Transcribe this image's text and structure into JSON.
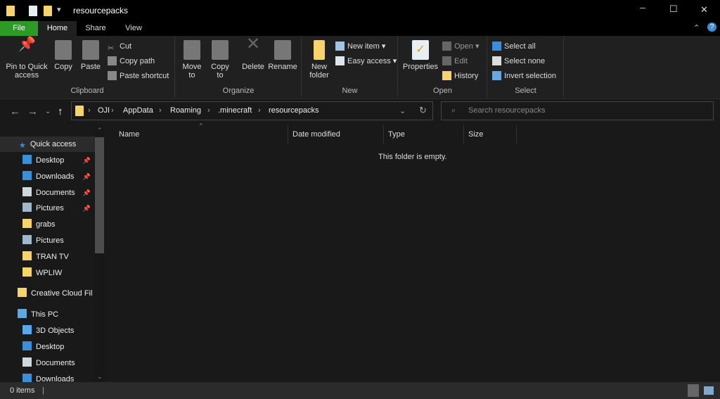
{
  "window": {
    "title": "resourcepacks",
    "minimize": "─",
    "maximize": "☐",
    "close": "✕"
  },
  "tabs": [
    {
      "label": "File"
    },
    {
      "label": "Home"
    },
    {
      "label": "Share"
    },
    {
      "label": "View"
    }
  ],
  "ribbon": {
    "clipboard": {
      "label": "Clipboard",
      "pin": "Pin to Quick access",
      "copy": "Copy",
      "paste": "Paste",
      "cut": "Cut",
      "copy_path": "Copy path",
      "paste_shortcut": "Paste shortcut"
    },
    "organize": {
      "label": "Organize",
      "move_to": "Move to",
      "copy_to": "Copy to",
      "delete": "Delete",
      "rename": "Rename"
    },
    "new": {
      "label": "New",
      "new_folder": "New folder",
      "new_item": "New item ▾",
      "easy_access": "Easy access ▾"
    },
    "open": {
      "label": "Open",
      "properties": "Properties",
      "open": "Open ▾",
      "edit": "Edit",
      "history": "History"
    },
    "select": {
      "label": "Select",
      "select_all": "Select all",
      "select_none": "Select none",
      "invert": "Invert selection"
    }
  },
  "address": {
    "crumbs": [
      "OJI",
      "AppData",
      "Roaming",
      ".minecraft",
      "resourcepacks"
    ],
    "search_placeholder": "Search resourcepacks"
  },
  "nav": {
    "quick_access": "Quick access",
    "items": [
      {
        "label": "Desktop",
        "pinned": true,
        "icon": "desktop-icon",
        "color": "#3b8fd9"
      },
      {
        "label": "Downloads",
        "pinned": true,
        "icon": "download-icon",
        "color": "#3b8fd9"
      },
      {
        "label": "Documents",
        "pinned": true,
        "icon": "document-icon",
        "color": "#cfd8dc"
      },
      {
        "label": "Pictures",
        "pinned": true,
        "icon": "pictures-icon",
        "color": "#9fb8cc"
      },
      {
        "label": "grabs",
        "pinned": false,
        "icon": "folder-icon",
        "color": "#f7d46b"
      },
      {
        "label": "Pictures",
        "pinned": false,
        "icon": "pictures-icon",
        "color": "#9fb8cc"
      },
      {
        "label": "TRAN TV",
        "pinned": false,
        "icon": "folder-icon",
        "color": "#f7d46b"
      },
      {
        "label": "WPLIW",
        "pinned": false,
        "icon": "folder-icon",
        "color": "#f7d46b"
      }
    ],
    "creative_cloud": "Creative Cloud Fil",
    "this_pc": "This PC",
    "pc_items": [
      {
        "label": "3D Objects",
        "color": "#5aa9e6"
      },
      {
        "label": "Desktop",
        "color": "#3b8fd9"
      },
      {
        "label": "Documents",
        "color": "#cfd8dc"
      },
      {
        "label": "Downloads",
        "color": "#3b8fd9"
      }
    ]
  },
  "columns": [
    "Name",
    "Date modified",
    "Type",
    "Size"
  ],
  "empty_message": "This folder is empty.",
  "status": {
    "items": "0 items"
  },
  "colors": {
    "file_tab": "#2d9a27",
    "folder": "#f7d46b",
    "accent": "#3b8fd9"
  }
}
